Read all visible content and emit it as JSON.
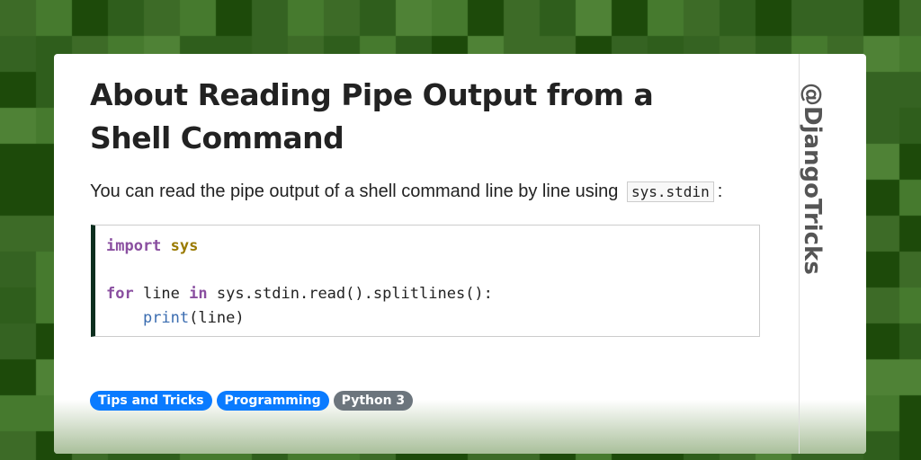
{
  "colors": {
    "tag_blue": "#0a7bff",
    "tag_gray": "#6c757d",
    "code_border": "#0c2e1e"
  },
  "title": "About Reading Pipe Output from a Shell Command",
  "intro": {
    "text": "You can read the pipe output of a shell command line by line using",
    "code": "sys.stdin",
    "suffix": ":"
  },
  "code": {
    "kw_import": "import",
    "mod_sys": "sys",
    "kw_for": "for",
    "var_line": " line ",
    "kw_in": "in",
    "rest": " sys.stdin.read().splitlines():",
    "indent": "    ",
    "bi_print": "print",
    "print_args": "(line)"
  },
  "tags": [
    {
      "label": "Tips and Tricks"
    },
    {
      "label": "Programming"
    },
    {
      "label": "Python 3"
    }
  ],
  "handle": "@DjangoTricks"
}
